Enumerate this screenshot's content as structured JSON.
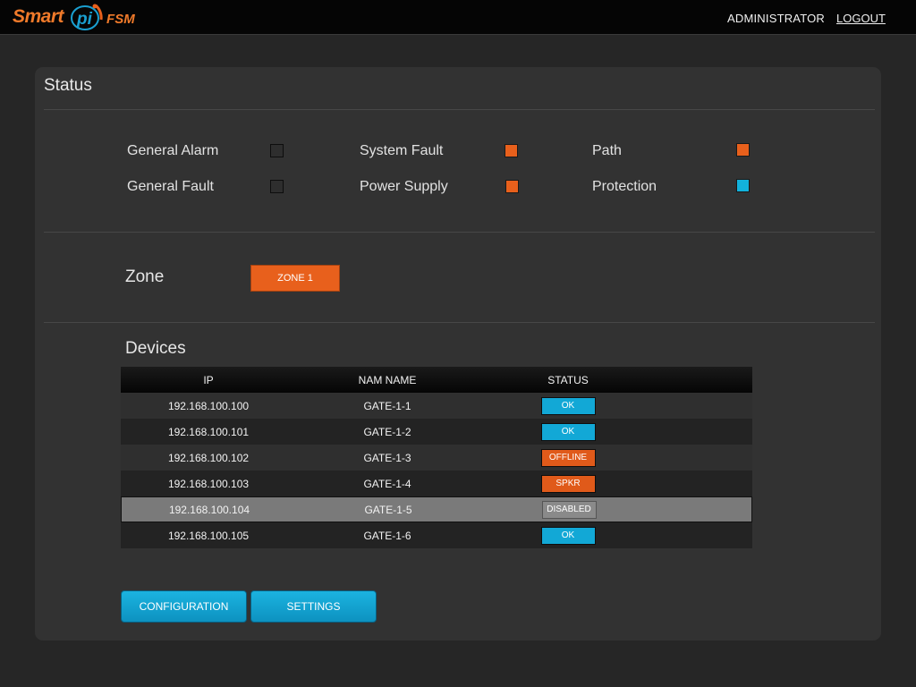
{
  "header": {
    "logo": {
      "smart": "Smart",
      "mark": "pi",
      "product": "FSM"
    },
    "user": "ADMINISTRATOR",
    "logout": "LOGOUT"
  },
  "status": {
    "title": "Status",
    "indicators": [
      {
        "label": "General Alarm",
        "state": "off"
      },
      {
        "label": "General Fault",
        "state": "off"
      },
      {
        "label": "System Fault",
        "state": "orange"
      },
      {
        "label": "Power Supply",
        "state": "orange"
      },
      {
        "label": "Path",
        "state": "orange"
      },
      {
        "label": "Protection",
        "state": "blue"
      }
    ]
  },
  "zone": {
    "label": "Zone",
    "button": "ZONE 1"
  },
  "devices": {
    "title": "Devices",
    "columns": [
      "IP",
      "NAM NAME",
      "STATUS"
    ],
    "rows": [
      {
        "ip": "192.168.100.100",
        "name": "GATE-1-1",
        "status": "OK"
      },
      {
        "ip": "192.168.100.101",
        "name": "GATE-1-2",
        "status": "OK"
      },
      {
        "ip": "192.168.100.102",
        "name": "GATE-1-3",
        "status": "OFFLINE"
      },
      {
        "ip": "192.168.100.103",
        "name": "GATE-1-4",
        "status": "SPKR"
      },
      {
        "ip": "192.168.100.104",
        "name": "GATE-1-5",
        "status": "DISABLED"
      },
      {
        "ip": "192.168.100.105",
        "name": "GATE-1-6",
        "status": "OK"
      }
    ]
  },
  "buttons": {
    "configuration": "CONFIGURATION",
    "settings": "SETTINGS"
  },
  "colors": {
    "accent_orange": "#e8601c",
    "accent_blue": "#12b2dc",
    "background": "#262626",
    "panel": "#323232"
  }
}
